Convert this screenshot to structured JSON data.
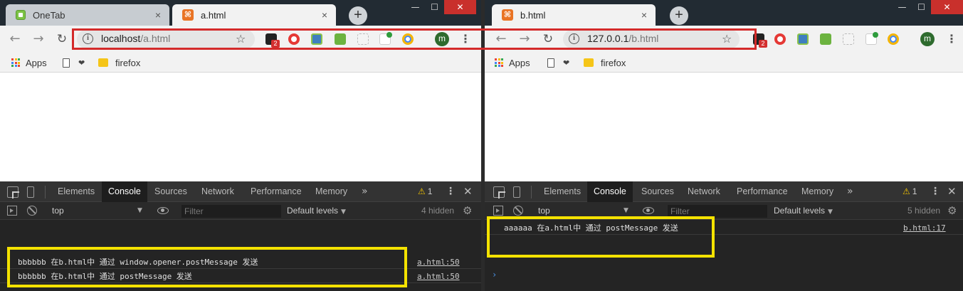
{
  "left": {
    "tabs": [
      {
        "title": "OneTab",
        "active": false,
        "favicon": "onetab-icon"
      },
      {
        "title": "a.html",
        "active": true,
        "favicon": "xml-file-icon"
      }
    ],
    "address": {
      "host": "localhost",
      "path": "/a.html"
    },
    "extension_badge": "2",
    "avatar_letter": "m",
    "bookmarks": {
      "apps": "Apps",
      "folder": "firefox"
    },
    "devtools": {
      "tabs": [
        "Elements",
        "Console",
        "Sources",
        "Network",
        "Performance",
        "Memory"
      ],
      "more": "»",
      "warnings": "1",
      "context": "top",
      "filter_placeholder": "Filter",
      "levels": "Default levels",
      "hidden": "4 hidden",
      "messages": [
        {
          "text": "bbbbbb 在b.html中 通过 window.opener.postMessage 发送",
          "source": "a.html:50"
        },
        {
          "text": "bbbbbb 在b.html中 通过 postMessage 发送",
          "source": "a.html:50"
        }
      ]
    }
  },
  "right": {
    "tabs": [
      {
        "title": "b.html",
        "active": true,
        "favicon": "xml-file-icon"
      }
    ],
    "address": {
      "host": "127.0.0.1",
      "path": "/b.html"
    },
    "extension_badge": "2",
    "avatar_letter": "m",
    "bookmarks": {
      "apps": "Apps",
      "folder": "firefox"
    },
    "devtools": {
      "tabs": [
        "Elements",
        "Console",
        "Sources",
        "Network",
        "Performance",
        "Memory"
      ],
      "more": "»",
      "warnings": "1",
      "context": "top",
      "filter_placeholder": "Filter",
      "levels": "Default levels",
      "hidden": "5 hidden",
      "messages": [
        {
          "text": "aaaaaa 在a.html中 通过 postMessage 发送",
          "source": "b.html:17"
        }
      ],
      "prompt": "›"
    }
  },
  "icons": {
    "close_tab": "×",
    "new_tab": "+",
    "back": "←",
    "forward": "→",
    "reload": "↻",
    "star": "☆",
    "menu": "⋮",
    "warning": "⚠",
    "close_panel": "✕",
    "gear": "⚙",
    "dropdown": "▼",
    "heart": "❤",
    "minimize": "—",
    "maximize": "☐",
    "window_close": "✕"
  },
  "colors": {
    "highlight_red": "#d42a2a",
    "highlight_yellow": "#f4e200",
    "link": "#4a90e2"
  }
}
